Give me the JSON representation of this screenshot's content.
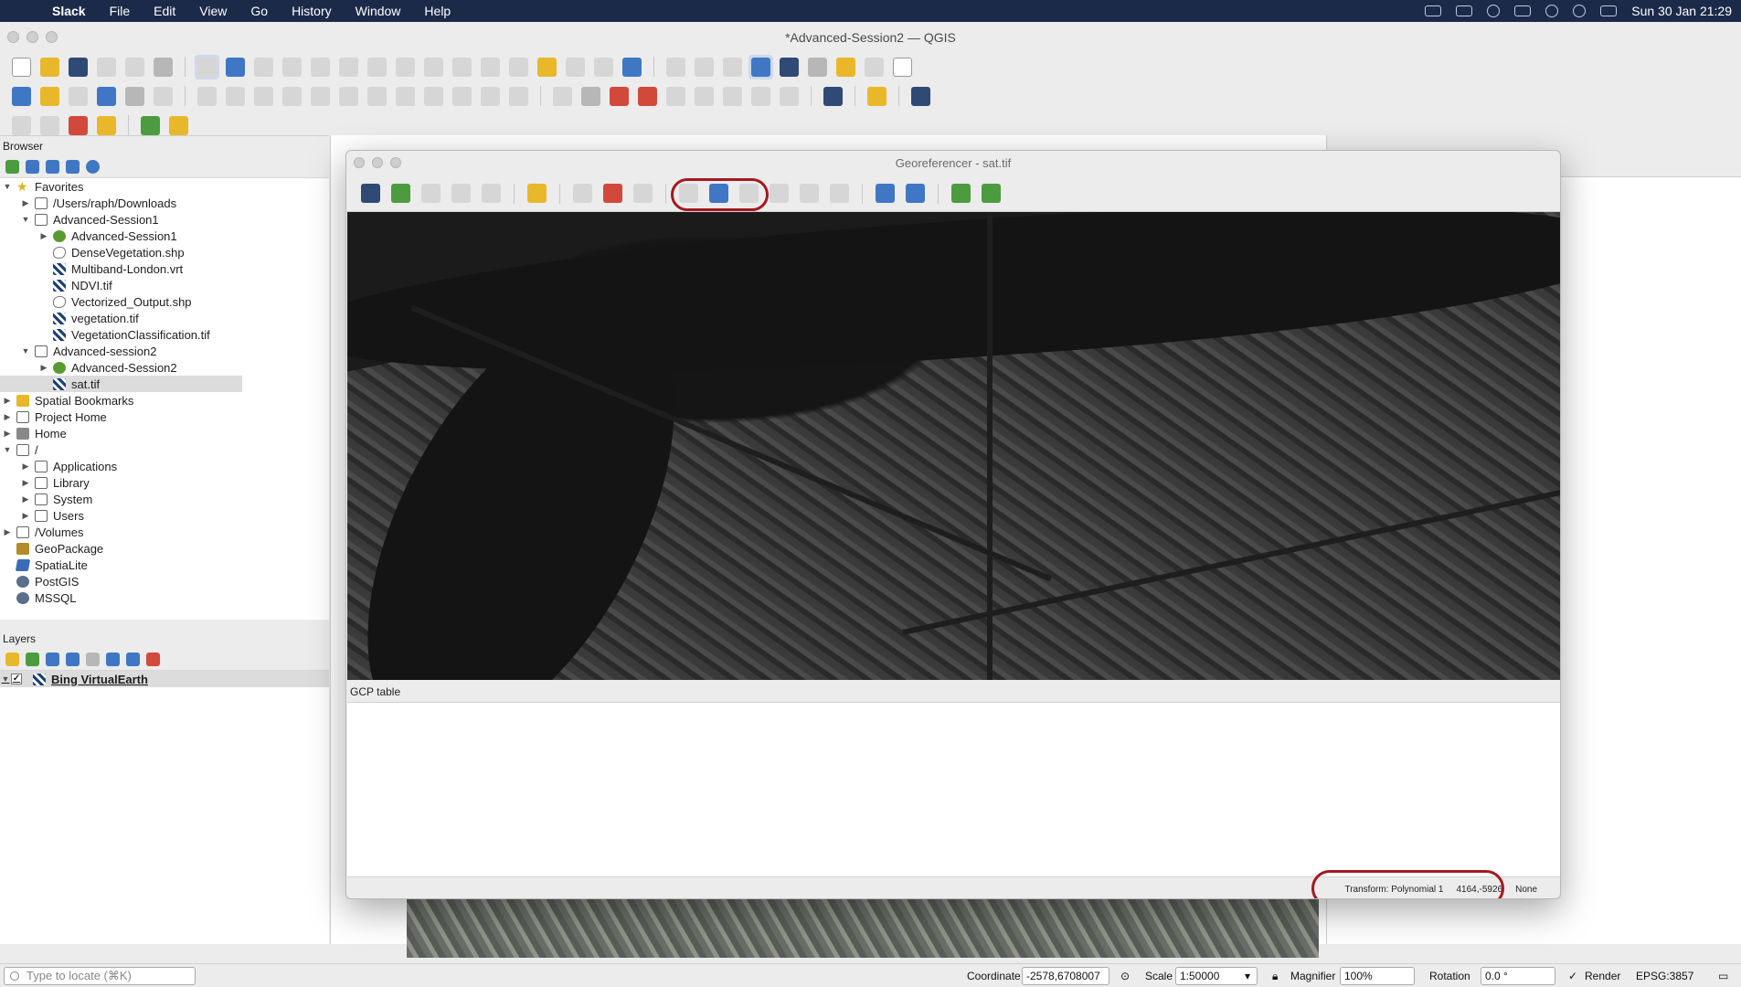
{
  "menubar": {
    "app": "Slack",
    "items": [
      "File",
      "Edit",
      "View",
      "Go",
      "History",
      "Window",
      "Help"
    ],
    "clock": "Sun 30 Jan  21:29"
  },
  "qgis": {
    "title": "*Advanced-Session2 — QGIS"
  },
  "browser": {
    "title": "Browser",
    "tree": [
      {
        "label": "Favorites",
        "icon": "star-icon",
        "depth": 0,
        "arrow": "▼"
      },
      {
        "label": "/Users/raph/Downloads",
        "icon": "folder-icon",
        "depth": 1,
        "arrow": "▶"
      },
      {
        "label": "Advanced-Session1",
        "icon": "folder-icon",
        "depth": 1,
        "arrow": "▼"
      },
      {
        "label": "Advanced-Session1",
        "icon": "qgis-project-icon",
        "depth": 2,
        "arrow": "▶"
      },
      {
        "label": "DenseVegetation.shp",
        "icon": "vector-icon",
        "depth": 2,
        "arrow": ""
      },
      {
        "label": "Multiband-London.vrt",
        "icon": "raster-icon",
        "depth": 2,
        "arrow": ""
      },
      {
        "label": "NDVI.tif",
        "icon": "raster-icon",
        "depth": 2,
        "arrow": ""
      },
      {
        "label": "Vectorized_Output.shp",
        "icon": "vector-icon",
        "depth": 2,
        "arrow": ""
      },
      {
        "label": "vegetation.tif",
        "icon": "raster-icon",
        "depth": 2,
        "arrow": ""
      },
      {
        "label": "VegetationClassification.tif",
        "icon": "raster-icon",
        "depth": 2,
        "arrow": ""
      },
      {
        "label": "Advanced-session2",
        "icon": "folder-icon",
        "depth": 1,
        "arrow": "▼"
      },
      {
        "label": "Advanced-Session2",
        "icon": "qgis-project-icon",
        "depth": 2,
        "arrow": "▶"
      },
      {
        "label": "sat.tif",
        "icon": "raster-icon",
        "depth": 2,
        "arrow": "",
        "selected": true
      },
      {
        "label": "Spatial Bookmarks",
        "icon": "bookmark-icon",
        "depth": 0,
        "arrow": "▶"
      },
      {
        "label": "Project Home",
        "icon": "folder-icon",
        "depth": 0,
        "arrow": "▶"
      },
      {
        "label": "Home",
        "icon": "home-icon",
        "depth": 0,
        "arrow": "▶"
      },
      {
        "label": "/",
        "icon": "folder-icon",
        "depth": 0,
        "arrow": "▼"
      },
      {
        "label": "Applications",
        "icon": "folder-icon",
        "depth": 1,
        "arrow": "▶"
      },
      {
        "label": "Library",
        "icon": "folder-icon",
        "depth": 1,
        "arrow": "▶"
      },
      {
        "label": "System",
        "icon": "folder-icon",
        "depth": 1,
        "arrow": "▶"
      },
      {
        "label": "Users",
        "icon": "folder-icon",
        "depth": 1,
        "arrow": "▶"
      },
      {
        "label": "/Volumes",
        "icon": "folder-icon",
        "depth": 0,
        "arrow": "▶"
      },
      {
        "label": "GeoPackage",
        "icon": "geopackage-icon",
        "depth": 0,
        "arrow": ""
      },
      {
        "label": "SpatiaLite",
        "icon": "spatialite-icon",
        "depth": 0,
        "arrow": ""
      },
      {
        "label": "PostGIS",
        "icon": "database-icon",
        "depth": 0,
        "arrow": ""
      },
      {
        "label": "MSSQL",
        "icon": "database-icon",
        "depth": 0,
        "arrow": ""
      }
    ]
  },
  "layers": {
    "title": "Layers",
    "items": [
      {
        "label": "Bing VirtualEarth",
        "checked": true
      }
    ]
  },
  "georef": {
    "title": "Georeferencer - sat.tif",
    "gcp_title": "GCP table",
    "status": {
      "transform": "Transform: Polynomial 1",
      "coords": "4164,-5926",
      "crs": "None"
    }
  },
  "statusbar": {
    "locate_placeholder": "Type to locate (⌘K)",
    "coordinate_label": "Coordinate",
    "coordinate_value": "-2578,6708007",
    "scale_label": "Scale",
    "scale_value": "1:50000",
    "magnifier_label": "Magnifier",
    "magnifier_value": "100%",
    "rotation_label": "Rotation",
    "rotation_value": "0.0 °",
    "render_label": "Render",
    "crs": "EPSG:3857"
  },
  "colors": {
    "highlight": "#a4191f",
    "menubar": "#1c2a4a",
    "selection": "#dcdcdc"
  }
}
